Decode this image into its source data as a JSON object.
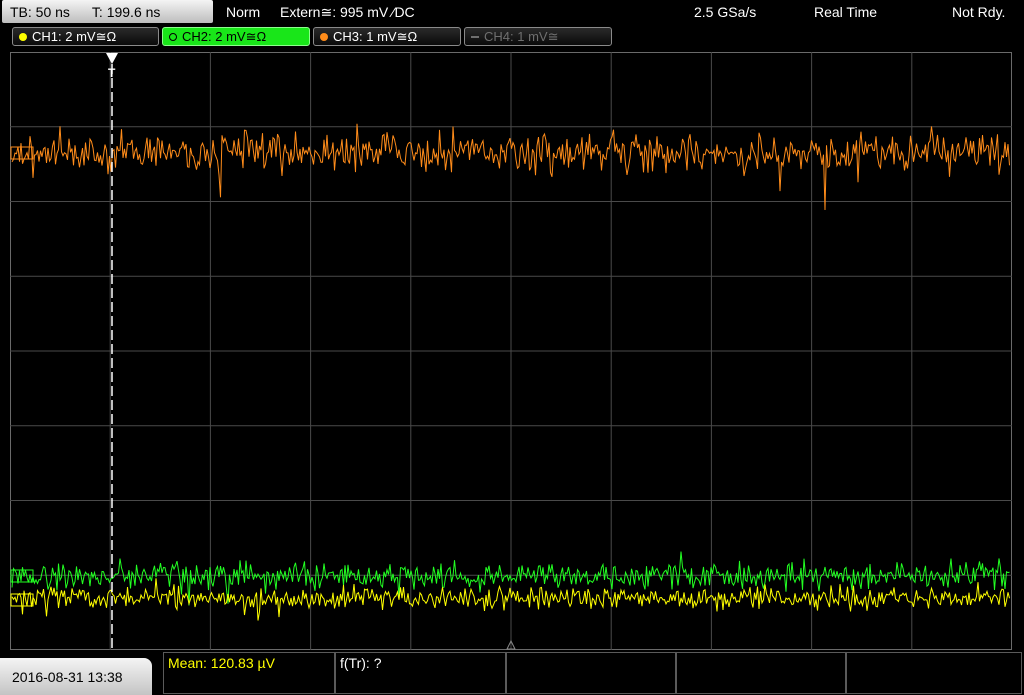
{
  "header": {
    "timebase": "TB: 50 ns",
    "trigger_time": "T: 199.6 ns",
    "trigger_mode": "Norm",
    "trigger_source": "Extern≅: 995 mV ⁄DC",
    "sample_rate": "2.5 GSa/s",
    "acq_mode": "Real Time",
    "status": "Not Rdy."
  },
  "channels": [
    {
      "label": "CH1: 2 mV≅Ω",
      "color": "#ffff00",
      "state": "on"
    },
    {
      "label": "CH2: 2 mV≅Ω",
      "color": "#22ff22",
      "state": "selected"
    },
    {
      "label": "CH3: 1 mV≅Ω",
      "color": "#ff8c1a",
      "state": "on"
    },
    {
      "label": "CH4: 1 mV≅",
      "color": "#777777",
      "state": "off"
    }
  ],
  "markers": {
    "trigger_label": "T"
  },
  "footer": {
    "datetime": "2016-08-31 13:38",
    "measurement": "Mean: 120.83 µV",
    "frequency": "f(Tr): ?"
  },
  "colors": {
    "ch1_trace": "#ffff00",
    "ch2_trace": "#22ff22",
    "ch3_trace": "#ff8c1a",
    "grid_line": "#4a4a4a",
    "grid_border": "#6a6a6a"
  }
}
